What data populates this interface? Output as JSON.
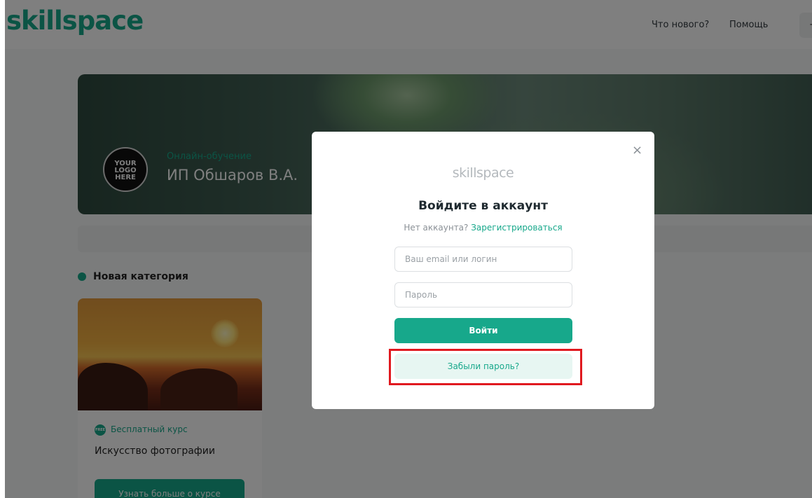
{
  "header": {
    "brand": "skillspace",
    "nav_new": "Что нового?",
    "nav_help": "Помощь",
    "nav_more": "+"
  },
  "banner": {
    "logo_text": "YOUR LOGO HERE",
    "subtitle": "Онлайн-обучение",
    "title": "ИП Обшаров В.А."
  },
  "category": {
    "label": "Новая категория"
  },
  "course_card": {
    "badge_text": "FREE",
    "badge_label": "Бесплатный курс",
    "title": "Искусство фотографии",
    "button_label": "Узнать больше о курсе"
  },
  "login_modal": {
    "close_glyph": "×",
    "logo": "skillspace",
    "title": "Войдите в аккаунт",
    "no_account_text": "Нет аккаунта?",
    "register_link": "Зарегистрироваться",
    "email_placeholder": "Ваш email или логин",
    "password_placeholder": "Пароль",
    "login_button": "Войти",
    "forgot_button": "Забыли пароль?"
  },
  "colors": {
    "accent": "#17a88b",
    "highlight": "#e0191f"
  }
}
